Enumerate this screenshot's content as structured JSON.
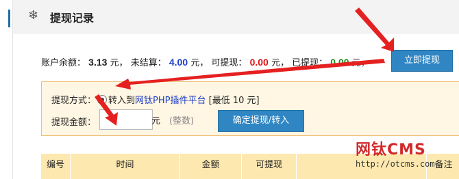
{
  "header": {
    "title": "提现记录",
    "icon": "snowflake-icon"
  },
  "balance": {
    "account_label": "账户余额：",
    "account_value": "3.13",
    "unit": "元，",
    "unsettled_label": "未结算：",
    "unsettled_value": "4.00",
    "available_label": "可提现：",
    "available_value": "0.00",
    "withdrawn_label": "已提现：",
    "withdrawn_value": "0.00",
    "colors": {
      "account": "#222222",
      "unsettled": "#1b3cc7",
      "available": "#e01010",
      "withdrawn": "#1a8f1a"
    }
  },
  "buttons": {
    "withdraw_now": "立即提现",
    "confirm": "确定提现/转入"
  },
  "form": {
    "method_label": "提现方式：",
    "method_prefix": "转入到",
    "method_link": "网钛PHP插件平台",
    "method_min": "[最低 10 元]",
    "amount_label": "提现金额：",
    "amount_value": "",
    "amount_unit": "元",
    "amount_hint": "(整数)"
  },
  "table": {
    "columns": [
      "编号",
      "时间",
      "金额",
      "可提现",
      "",
      "备注"
    ]
  },
  "watermark": {
    "logo": "网钛CMS",
    "url": "http://otcms.com"
  },
  "accent_color": "#2f86c3"
}
